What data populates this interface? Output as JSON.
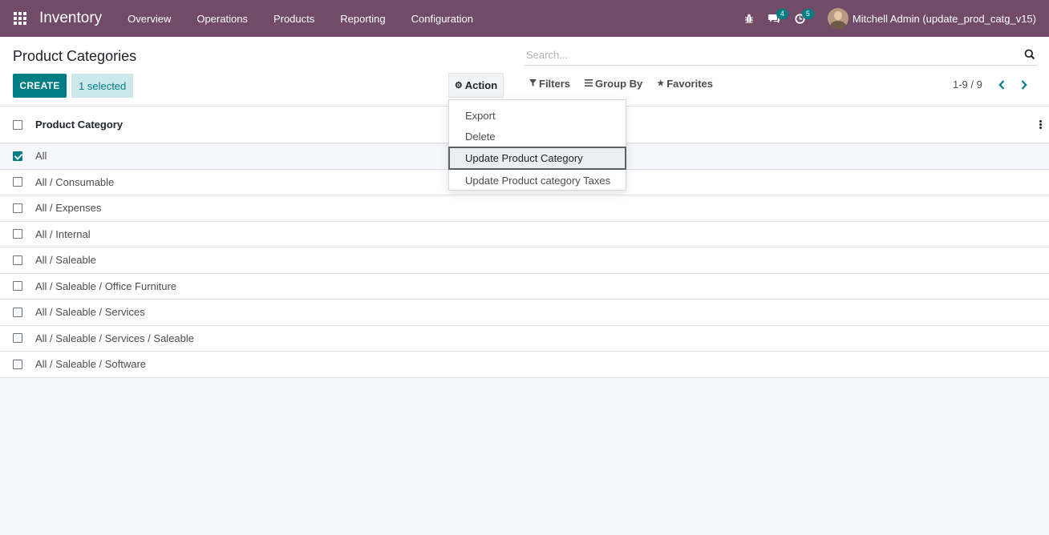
{
  "navbar": {
    "brand": "Inventory",
    "menu": [
      "Overview",
      "Operations",
      "Products",
      "Reporting",
      "Configuration"
    ],
    "messages_count": "4",
    "activities_count": "5",
    "user_name": "Mitchell Admin (update_prod_catg_v15)",
    "bg_color": "#714b67"
  },
  "control_panel": {
    "title": "Product Categories",
    "create_label": "CREATE",
    "selected_label": "1 selected",
    "action_label": "Action",
    "search_placeholder": "Search...",
    "filters_label": "Filters",
    "groupby_label": "Group By",
    "favorites_label": "Favorites",
    "pager": "1-9 / 9"
  },
  "action_menu": {
    "items": [
      "Export",
      "Delete",
      "Update Product Category",
      "Update Product category Taxes"
    ],
    "focused_index": 2
  },
  "list": {
    "column_header": "Product Category",
    "rows": [
      {
        "label": "All",
        "checked": true
      },
      {
        "label": "All / Consumable",
        "checked": false
      },
      {
        "label": "All / Expenses",
        "checked": false
      },
      {
        "label": "All / Internal",
        "checked": false
      },
      {
        "label": "All / Saleable",
        "checked": false
      },
      {
        "label": "All / Saleable / Office Furniture",
        "checked": false
      },
      {
        "label": "All / Saleable / Services",
        "checked": false
      },
      {
        "label": "All / Saleable / Services / Saleable",
        "checked": false
      },
      {
        "label": "All / Saleable / Software",
        "checked": false
      }
    ]
  },
  "colors": {
    "primary": "#017e84",
    "brand": "#714b67"
  }
}
